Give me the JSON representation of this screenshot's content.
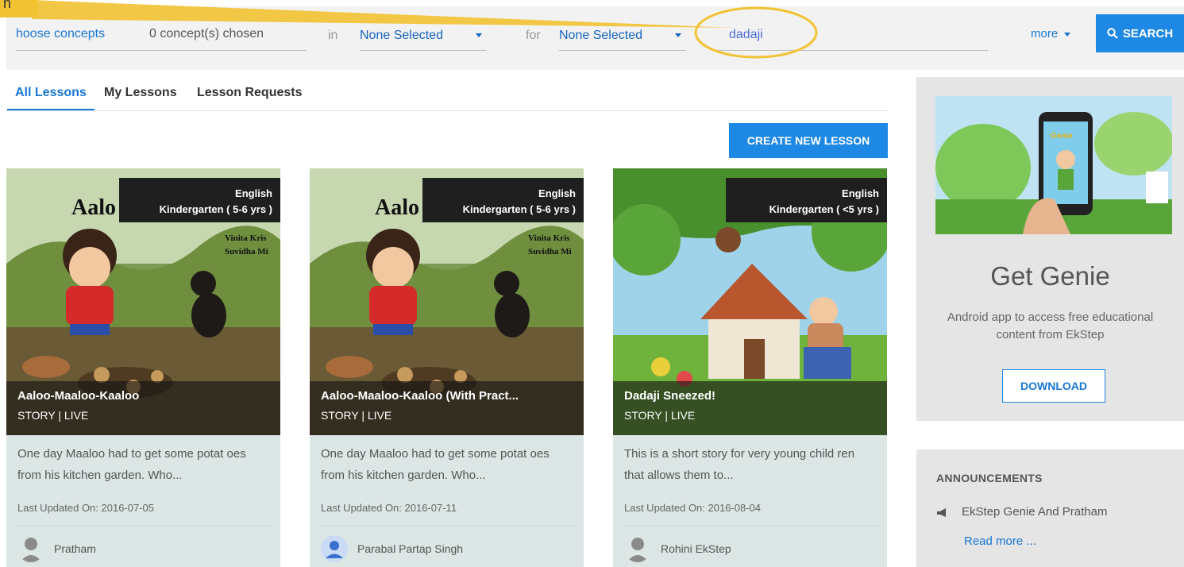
{
  "search": {
    "concepts_label": "hoose concepts",
    "concepts_count": "0 concept(s) chosen",
    "in_label": "in",
    "in_value": "None Selected",
    "for_label": "for",
    "for_value": "None Selected",
    "query": "dadaji",
    "more_label": "more",
    "search_label": "SEARCH"
  },
  "annotation": {
    "label": "n",
    "color": "#f1c232"
  },
  "tabs": [
    {
      "label": "All Lessons",
      "active": true
    },
    {
      "label": "My Lessons",
      "active": false
    },
    {
      "label": "Lesson Requests",
      "active": false
    }
  ],
  "create_label": "CREATE NEW LESSON",
  "cards": [
    {
      "language": "English",
      "grade": "Kindergarten ( 5-6 yrs )",
      "cover_title": "Aalo",
      "cover_authors": [
        "Vinita Kris",
        "Suvidha Mi"
      ],
      "title": "Aaloo-Maaloo-Kaaloo",
      "status": "STORY | LIVE",
      "description": "One day Maaloo had to get some potat oes from his kitchen garden. Who...",
      "updated": "Last Updated On: 2016-07-05",
      "author": "Pratham"
    },
    {
      "language": "English",
      "grade": "Kindergarten ( 5-6 yrs )",
      "cover_title": "Aalo",
      "cover_authors": [
        "Vinita Kris",
        "Suvidha Mi"
      ],
      "title": "Aaloo-Maaloo-Kaaloo (With Pract...",
      "status": "STORY | LIVE",
      "description": "One day Maaloo had to get some potat oes from his kitchen garden. Who...",
      "updated": "Last Updated On: 2016-07-11",
      "author": "Parabal Partap Singh"
    },
    {
      "language": "English",
      "grade": "Kindergarten ( <5 yrs )",
      "title": "Dadaji Sneezed!",
      "status": "STORY | LIVE",
      "description": "This is a short story for very young child ren that allows them to...",
      "updated": "Last Updated On: 2016-08-04",
      "author": "Rohini EkStep"
    }
  ],
  "promo": {
    "heading": "Get Genie",
    "subtitle": "Android app to access free educational content from EkStep",
    "download_label": "DOWNLOAD",
    "phone_logo": "Genie"
  },
  "announcements": {
    "heading": "ANNOUNCEMENTS",
    "item": "EkStep Genie And Pratham",
    "read_more": "Read more ..."
  },
  "colors": {
    "accent": "#1e88e5",
    "link": "#1976d2",
    "card_bg": "#dbe6e5",
    "panel_bg": "#e5e5e5"
  }
}
